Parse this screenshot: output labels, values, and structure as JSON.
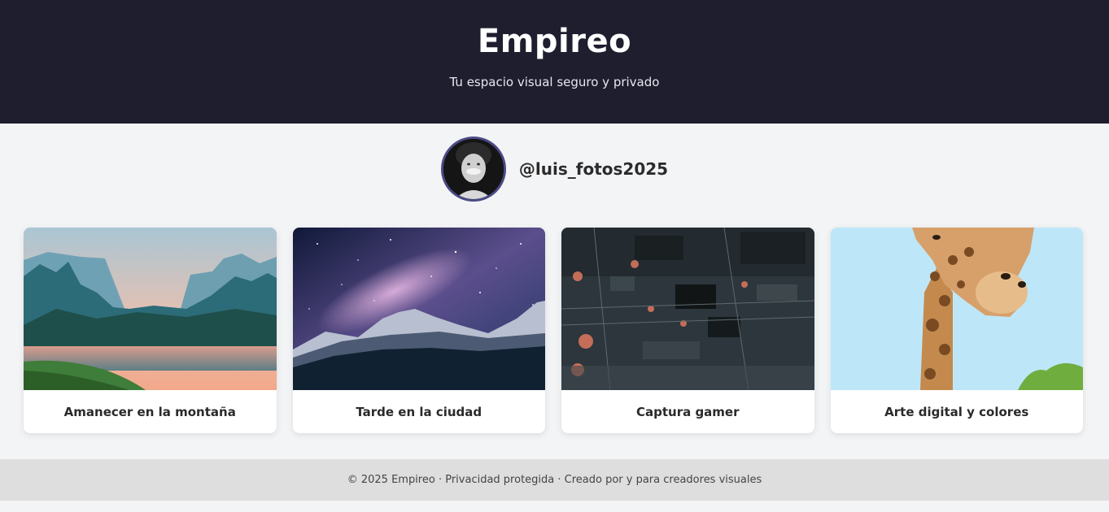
{
  "header": {
    "title": "Empireo",
    "tagline": "Tu espacio visual seguro y privado"
  },
  "profile": {
    "username": "@luis_fotos2025",
    "avatar_icon": "user-avatar-photo"
  },
  "gallery": [
    {
      "caption": "Amanecer en la montaña",
      "image": "mountain-lake-sunrise"
    },
    {
      "caption": "Tarde en la ciudad",
      "image": "starry-mountain-night"
    },
    {
      "caption": "Captura gamer",
      "image": "circuit-board"
    },
    {
      "caption": "Arte digital y colores",
      "image": "giraffe-portrait"
    }
  ],
  "footer": {
    "text": "© 2025 Empireo · Privacidad protegida · Creado por y para creadores visuales"
  },
  "colors": {
    "header_bg": "#1e1e2f",
    "page_bg": "#f3f4f6",
    "avatar_border": "#4b4a86",
    "footer_bg": "#dedede"
  }
}
